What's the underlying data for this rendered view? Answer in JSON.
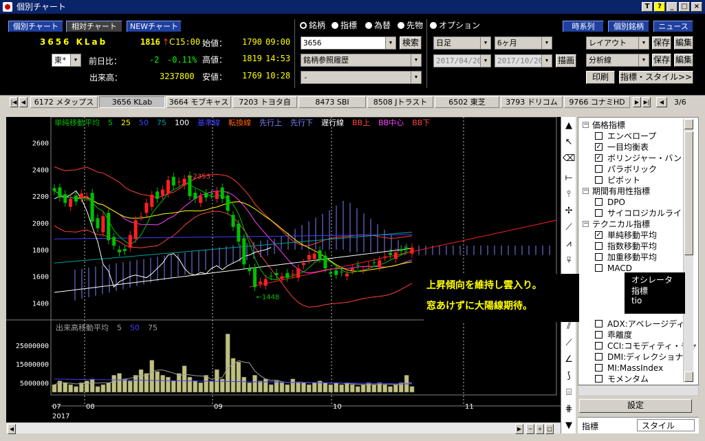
{
  "window": {
    "title": "個別チャート",
    "help": "?",
    "tbtn_t": "T"
  },
  "header": {
    "btn_kobetsu": "個別チャート",
    "btn_soutai": "相対チャート",
    "btn_new": "NEWチャート",
    "code_name": "3656 KLab",
    "last": "1816",
    "arrow": "↑",
    "cflag": "C",
    "time": "15:00",
    "market": "東*",
    "prevday_label": "前日比：",
    "diff": "-2",
    "pct": "-0.11%",
    "volume_label": "出来高：",
    "volume": "3237800",
    "open_label": "始値：",
    "open": "1790",
    "open_time": "09:00",
    "high_label": "高値：",
    "high": "1819",
    "high_time": "14:53",
    "low_label": "安値：",
    "low": "1769",
    "low_time": "10:28",
    "radios": [
      "銘柄",
      "指標",
      "為替",
      "先物",
      "オプション"
    ],
    "code_input": "3656",
    "search_btn": "検索",
    "history_label": "銘柄参照履歴",
    "blank_sel": "-",
    "period": "日足",
    "span": "6ヶ月",
    "date_from": "2017/04/20",
    "date_to": "2017/10/20",
    "draw_btn": "描画",
    "btn_jikeiretsu": "時系列",
    "btn_kobetsu_meigara": "個別銘柄",
    "btn_news": "ニュース",
    "layout": "レイアウト",
    "save1": "保存",
    "edit1": "編集",
    "analysis": "分析線",
    "save2": "保存",
    "edit2": "編集",
    "print_btn": "印刷",
    "style_btn": "指標・スタイル>>"
  },
  "tabs": [
    "6172 メタップス",
    "3656 KLab",
    "3664 モブキャス",
    "7203 トヨタ自",
    "8473 SBI",
    "8508 Jトラスト",
    "6502 東芝",
    "3793 ドリコム",
    "9766 コナミHD"
  ],
  "tab_page": "3/6",
  "chart_data": {
    "type": "candlestick",
    "legend": [
      {
        "t": "単純移動平均",
        "c": "#00c000"
      },
      {
        "t": "5",
        "c": "#00c000"
      },
      {
        "t": "25",
        "c": "#ffff00"
      },
      {
        "t": "50",
        "c": "#4040ff"
      },
      {
        "t": "75",
        "c": "#00a0a0"
      },
      {
        "t": "100",
        "c": "#ffffff"
      },
      {
        "t": "基準線",
        "c": "#4040ff"
      },
      {
        "t": "転換線",
        "c": "#ff6000"
      },
      {
        "t": "先行上",
        "c": "#8080ff"
      },
      {
        "t": "先行下",
        "c": "#8080ff"
      },
      {
        "t": "遅行線",
        "c": "#ffffff"
      },
      {
        "t": "BB上",
        "c": "#ff4040"
      },
      {
        "t": "BB中心",
        "c": "#ff40ff"
      },
      {
        "t": "BB下",
        "c": "#ff4040"
      }
    ],
    "ylabels": [
      "2600",
      "2400",
      "2200",
      "2000",
      "1800",
      "1600",
      "1400"
    ],
    "yvals": [
      2600,
      2400,
      2200,
      2000,
      1800,
      1600,
      1400
    ],
    "ylim": [
      1300,
      2700
    ],
    "max_label": "←2353",
    "min_label": "←1448",
    "xlabels": [
      "07",
      "08",
      "09",
      "10",
      "11"
    ],
    "year": "2017",
    "vol_legend": [
      {
        "t": "出来高移動平均",
        "c": "#a0a0a0"
      },
      {
        "t": "5",
        "c": "#a0a0a0"
      },
      {
        "t": "50",
        "c": "#4040ff"
      },
      {
        "t": "75",
        "c": "#a0a0a0"
      }
    ],
    "vol_ylabels": [
      "25000000",
      "15000000",
      "5000000"
    ],
    "vol_yvals": [
      25000000,
      15000000,
      5000000
    ],
    "vol_ylim": [
      0,
      33000000
    ],
    "closes": [
      2240,
      2190,
      2150,
      2180,
      2160,
      2220,
      2200,
      2010,
      1960,
      2050,
      1870,
      1830,
      1780,
      1790,
      1910,
      2020,
      2050,
      2150,
      2210,
      2180,
      2250,
      2320,
      2280,
      2310,
      2330,
      2200,
      2180,
      2200,
      2190,
      2210,
      2240,
      2180,
      2090,
      1970,
      1860,
      1690,
      1640,
      1520,
      1560,
      1580,
      1600,
      1610,
      1600,
      1590,
      1620,
      1660,
      1700,
      1760,
      1770,
      1730,
      1660,
      1620,
      1610,
      1630,
      1620,
      1660,
      1680,
      1650,
      1680,
      1700,
      1720,
      1750,
      1760,
      1780,
      1790,
      1800,
      1816
    ],
    "volumes": [
      4000000,
      6000000,
      5000000,
      4000000,
      3000000,
      5000000,
      6000000,
      7000000,
      3000000,
      4000000,
      5000000,
      9000000,
      10000000,
      7000000,
      6000000,
      9000000,
      12000000,
      10000000,
      17000000,
      11000000,
      9000000,
      8000000,
      6000000,
      10000000,
      14000000,
      8000000,
      6000000,
      5000000,
      9000000,
      6000000,
      12000000,
      7000000,
      31000000,
      18000000,
      16000000,
      8000000,
      5000000,
      9000000,
      6000000,
      7000000,
      4000000,
      6000000,
      5000000,
      4000000,
      7000000,
      5000000,
      5000000,
      4000000,
      5000000,
      6000000,
      5000000,
      4000000,
      5000000,
      4000000,
      5000000,
      4000000,
      3000000,
      4000000,
      5000000,
      4000000,
      5000000,
      4000000,
      3000000,
      4000000,
      5000000,
      9000000,
      3000000
    ]
  },
  "annotation": {
    "line1": "上昇傾向を維持し雲入り。",
    "line2": "窓あけずに大陽線期待。"
  },
  "popup": {
    "l1": "オシレータ",
    "l2": "指標",
    "l3": "tio"
  },
  "tree": [
    {
      "t": "価格指標",
      "lvl": 0,
      "exp": "−"
    },
    {
      "t": "エンベロープ",
      "lvl": 1,
      "chk": false
    },
    {
      "t": "一目均衡表",
      "lvl": 1,
      "chk": true
    },
    {
      "t": "ボリンジャー・バンド",
      "lvl": 1,
      "chk": true
    },
    {
      "t": "パラボリック",
      "lvl": 1,
      "chk": false
    },
    {
      "t": "ピボット",
      "lvl": 1,
      "chk": false
    },
    {
      "t": "期間有用性指標",
      "lvl": 0,
      "exp": "−"
    },
    {
      "t": "DPO",
      "lvl": 1,
      "chk": false
    },
    {
      "t": "サイコロジカルライン",
      "lvl": 1,
      "chk": false
    },
    {
      "t": "テクニカル指標",
      "lvl": 0,
      "exp": "−"
    },
    {
      "t": "単純移動平均",
      "lvl": 1,
      "chk": true
    },
    {
      "t": "指数移動平均",
      "lvl": 1,
      "chk": false
    },
    {
      "t": "加重移動平均",
      "lvl": 1,
      "chk": false
    },
    {
      "t": "MACD",
      "lvl": 1,
      "chk": false
    }
  ],
  "tree2": [
    {
      "t": "ADX:アベレージディレ",
      "lvl": 1,
      "chk": false
    },
    {
      "t": "乖離度",
      "lvl": 1,
      "chk": false
    },
    {
      "t": "CCI:コモディティ・チャ",
      "lvl": 1,
      "chk": false
    },
    {
      "t": "DMI:ディレクショナル",
      "lvl": 1,
      "chk": false
    },
    {
      "t": "MI:MassIndex",
      "lvl": 1,
      "chk": false
    },
    {
      "t": "モメンタム",
      "lvl": 1,
      "chk": false
    }
  ],
  "side_btn": "設定",
  "side_tabs": [
    "指標",
    "スタイル"
  ]
}
